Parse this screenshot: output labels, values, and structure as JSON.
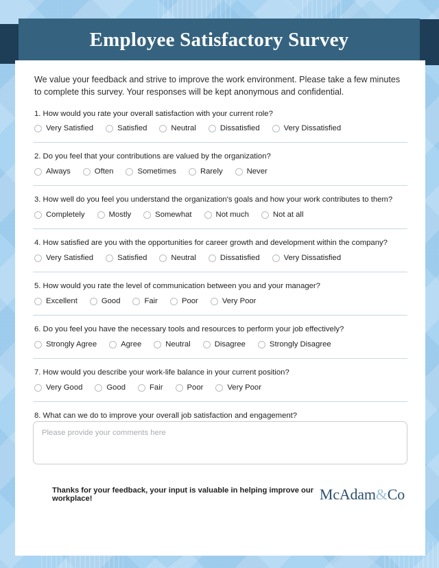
{
  "header": {
    "title": "Employee Satisfactory Survey"
  },
  "intro": {
    "text": "We value your feedback and strive to improve the work environment. Please take a few minutes to complete this survey. Your responses will be kept anonymous and confidential."
  },
  "questions": [
    {
      "number": "1.",
      "text": "1. How would you rate your overall satisfaction with your current role?",
      "options": [
        "Very Satisfied",
        "Satisfied",
        "Neutral",
        "Dissatisfied",
        "Very Dissatisfied"
      ]
    },
    {
      "number": "2.",
      "text": "2. Do you feel that your contributions are valued by the organization?",
      "options": [
        "Always",
        "Often",
        "Sometimes",
        "Rarely",
        "Never"
      ]
    },
    {
      "number": "3.",
      "text": "3. How well do you feel you understand the organization's goals and how your work contributes to them?",
      "options": [
        "Completely",
        "Mostly",
        "Somewhat",
        "Not much",
        "Not at all"
      ]
    },
    {
      "number": "4.",
      "text": "4. How satisfied are you with the opportunities for career growth and development within the company?",
      "options": [
        "Very Satisfied",
        "Satisfied",
        "Neutral",
        "Dissatisfied",
        "Very Dissatisfied"
      ]
    },
    {
      "number": "5.",
      "text": "5. How would you rate the level of communication between you and your manager?",
      "options": [
        "Excellent",
        "Good",
        "Fair",
        "Poor",
        "Very Poor"
      ]
    },
    {
      "number": "6.",
      "text": "6. Do you feel you have the necessary tools and resources to perform your job effectively?",
      "options": [
        "Strongly Agree",
        "Agree",
        "Neutral",
        "Disagree",
        "Strongly Disagree"
      ]
    },
    {
      "number": "7.",
      "text": "7. How would you describe your work-life balance in your current position?",
      "options": [
        "Very Good",
        "Good",
        "Fair",
        "Poor",
        "Very Poor"
      ]
    }
  ],
  "comment_question": {
    "text": "8. What can we do to improve your overall job satisfaction and engagement?",
    "placeholder": "Please provide your comments here",
    "value": ""
  },
  "footer": {
    "thanks": "Thanks for your feedback, your input is valuable in helping improve our workplace!",
    "logo_main": "McAdam",
    "logo_amp": "&",
    "logo_suffix": "Co"
  },
  "colors": {
    "banner": "#35637f",
    "banner_shadow": "#1e3d57",
    "background": "#a9d4f2",
    "divider": "#c8d7e4",
    "logo_dark": "#2c4f6e",
    "logo_light": "#9dc2dc"
  }
}
